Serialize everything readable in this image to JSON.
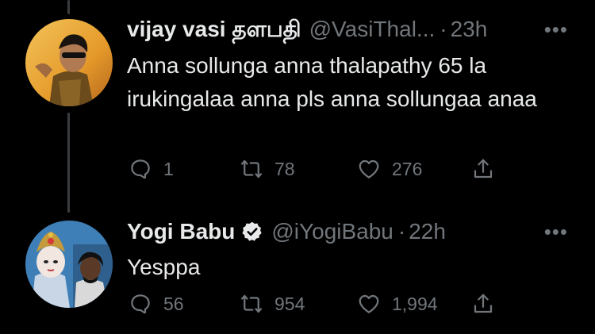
{
  "tweets": [
    {
      "author_name": "vijay vasi தளபதி",
      "handle": "@VasiThal...",
      "separator": "·",
      "time": "23h",
      "more_icon": "more-dots-icon",
      "text": "Anna sollunga anna thalapathy 65 la irukingalaa anna pls anna sollungaa anaa",
      "verified": false,
      "actions": {
        "replies": "1",
        "retweets": "78",
        "likes": "276"
      }
    },
    {
      "author_name": "Yogi Babu",
      "handle": "@iYogiBabu",
      "separator": "·",
      "time": "22h",
      "more_icon": "more-dots-icon",
      "text": "Yesppa",
      "verified": true,
      "actions": {
        "replies": "56",
        "retweets": "954",
        "likes": "1,994"
      }
    }
  ],
  "colors": {
    "background": "#000000",
    "text": "#e7e9ea",
    "muted": "#71767b",
    "thread_line": "#3a3d40"
  }
}
